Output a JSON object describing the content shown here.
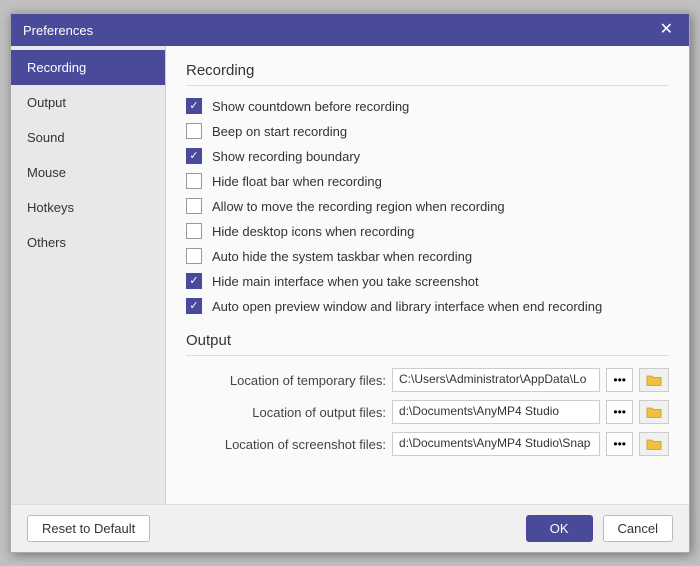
{
  "dialog": {
    "title": "Preferences",
    "close_label": "✕"
  },
  "sidebar": {
    "items": [
      {
        "id": "recording",
        "label": "Recording",
        "active": true
      },
      {
        "id": "output",
        "label": "Output",
        "active": false
      },
      {
        "id": "sound",
        "label": "Sound",
        "active": false
      },
      {
        "id": "mouse",
        "label": "Mouse",
        "active": false
      },
      {
        "id": "hotkeys",
        "label": "Hotkeys",
        "active": false
      },
      {
        "id": "others",
        "label": "Others",
        "active": false
      }
    ]
  },
  "recording": {
    "section_title": "Recording",
    "checkboxes": [
      {
        "id": "show-countdown",
        "label": "Show countdown before recording",
        "checked": true
      },
      {
        "id": "beep-on-start",
        "label": "Beep on start recording",
        "checked": false
      },
      {
        "id": "show-boundary",
        "label": "Show recording boundary",
        "checked": true
      },
      {
        "id": "hide-float-bar",
        "label": "Hide float bar when recording",
        "checked": false
      },
      {
        "id": "allow-move",
        "label": "Allow to move the recording region when recording",
        "checked": false
      },
      {
        "id": "hide-desktop-icons",
        "label": "Hide desktop icons when recording",
        "checked": false
      },
      {
        "id": "auto-hide-taskbar",
        "label": "Auto hide the system taskbar when recording",
        "checked": false
      },
      {
        "id": "hide-main-interface",
        "label": "Hide main interface when you take screenshot",
        "checked": true
      },
      {
        "id": "auto-open-preview",
        "label": "Auto open preview window and library interface when end recording",
        "checked": true
      }
    ]
  },
  "output": {
    "section_title": "Output",
    "rows": [
      {
        "id": "temp-files",
        "label": "Location of temporary files:",
        "value": "C:\\Users\\Administrator\\AppData\\Lo",
        "dots": "•••"
      },
      {
        "id": "output-files",
        "label": "Location of output files:",
        "value": "d:\\Documents\\AnyMP4 Studio",
        "dots": "•••"
      },
      {
        "id": "screenshot-files",
        "label": "Location of screenshot files:",
        "value": "d:\\Documents\\AnyMP4 Studio\\Snap",
        "dots": "•••"
      }
    ]
  },
  "footer": {
    "reset_label": "Reset to Default",
    "ok_label": "OK",
    "cancel_label": "Cancel"
  }
}
